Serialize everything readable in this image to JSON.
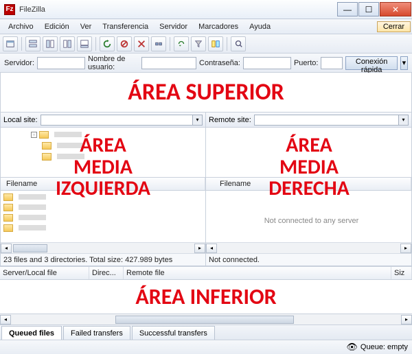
{
  "titlebar": {
    "title": "FileZilla"
  },
  "menu": {
    "file": "Archivo",
    "edit": "Edición",
    "view": "Ver",
    "transfer": "Transferencia",
    "server": "Servidor",
    "bookmarks": "Marcadores",
    "help": "Ayuda",
    "close_btn": "Cerrar"
  },
  "quickconnect": {
    "host_label": "Servidor:",
    "user_label": "Nombre de usuario:",
    "pass_label": "Contraseña:",
    "port_label": "Puerto:",
    "button": "Conexión rápida"
  },
  "annotations": {
    "top": "ÁREA SUPERIOR",
    "mid_left": "ÁREA\nMEDIA\nIZQUIERDA",
    "mid_right": "ÁREA\nMEDIA\nDERECHA",
    "bottom": "ÁREA INFERIOR"
  },
  "local": {
    "label": "Local site:",
    "filename_header": "Filename",
    "status": "23 files and 3 directories. Total size: 427.989 bytes"
  },
  "remote": {
    "label": "Remote site:",
    "filename_header": "Filename",
    "not_connected_tree": "Not connected to any server",
    "status": "Not connected."
  },
  "queue": {
    "col_server": "Server/Local file",
    "col_direc": "Direc...",
    "col_remote": "Remote file",
    "col_size": "Siz",
    "tab_queued": "Queued files",
    "tab_failed": "Failed transfers",
    "tab_success": "Successful transfers"
  },
  "statusbar": {
    "queue_label": "Queue: empty"
  }
}
